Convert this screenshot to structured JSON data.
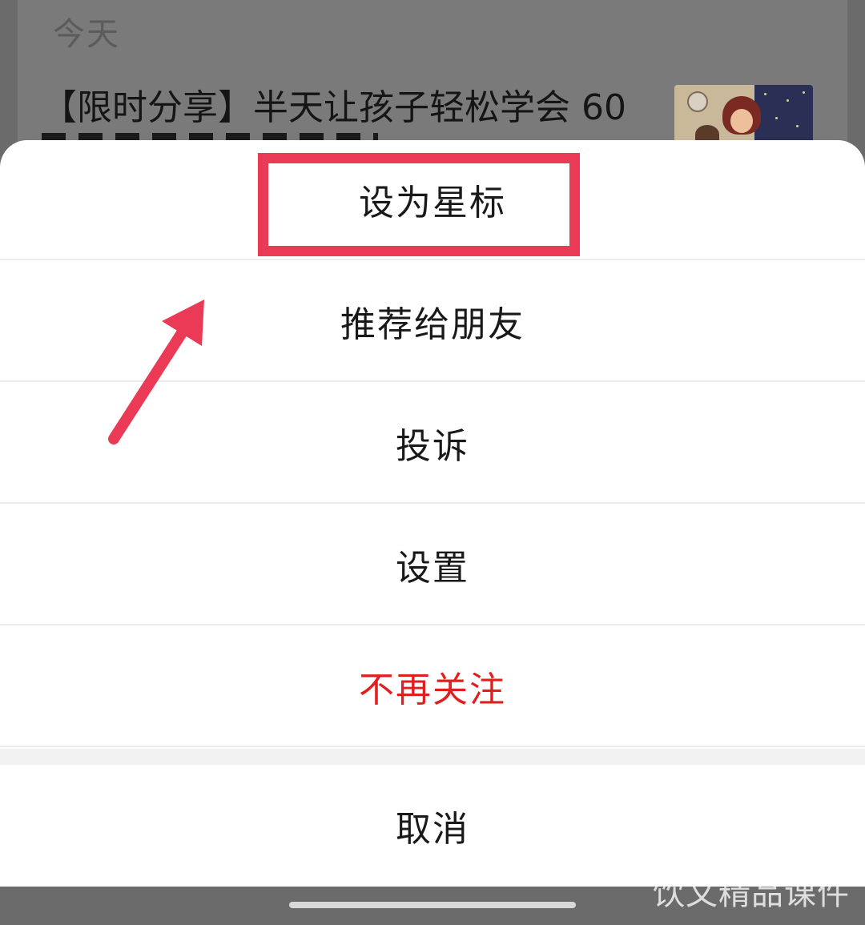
{
  "background": {
    "date_label": "今天",
    "article_title": "【限时分享】半天让孩子轻松学会 60"
  },
  "action_sheet": {
    "items": [
      {
        "label": "设为星标"
      },
      {
        "label": "推荐给朋友"
      },
      {
        "label": "投诉"
      },
      {
        "label": "设置"
      },
      {
        "label": "不再关注",
        "color": "#e02020"
      }
    ],
    "cancel_label": "取消"
  },
  "annotation": {
    "highlight_color": "#ea3a55",
    "highlighted_item": "设为星标"
  },
  "watermark": "饮文精品课件"
}
